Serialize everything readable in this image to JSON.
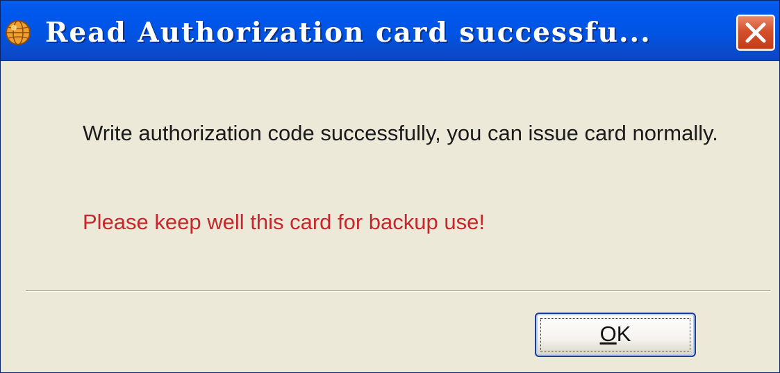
{
  "window": {
    "title": "Read Authorization card successfu...",
    "icon": "app-globe-icon",
    "close_icon": "close-icon",
    "close_color": "#d4512c",
    "titlebar_color": "#0054e3"
  },
  "dialog": {
    "message": "Write authorization code successfully, you can issue card normally.",
    "warning": "Please keep well this card for backup use!",
    "warning_color": "#c4282c",
    "ok_label": "OK"
  }
}
